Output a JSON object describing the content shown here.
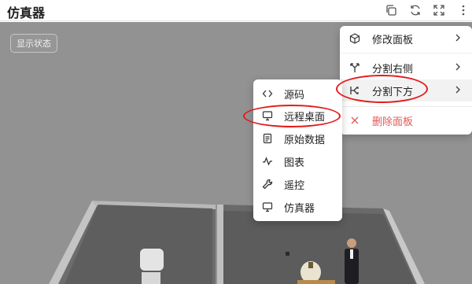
{
  "header": {
    "title": "仿真器",
    "icons": [
      "copy-icon",
      "refresh-icon",
      "expand-icon",
      "more-vertical-icon"
    ]
  },
  "scene": {
    "status_button": "显示状态"
  },
  "panel_menu": {
    "items": [
      {
        "label": "修改面板",
        "icon": "cube-icon",
        "has_submenu": true
      },
      {
        "label": "分割右侧",
        "icon": "split-right-icon",
        "has_submenu": true
      },
      {
        "label": "分割下方",
        "icon": "split-down-icon",
        "has_submenu": true
      },
      {
        "label": "删除面板",
        "icon": "close-icon",
        "has_submenu": false,
        "color": "#e35a55"
      }
    ]
  },
  "submenu": {
    "items": [
      {
        "label": "源码",
        "icon": "code-icon"
      },
      {
        "label": "远程桌面",
        "icon": "monitor-icon"
      },
      {
        "label": "原始数据",
        "icon": "document-icon"
      },
      {
        "label": "图表",
        "icon": "chart-line-icon"
      },
      {
        "label": "遥控",
        "icon": "wrench-icon"
      },
      {
        "label": "仿真器",
        "icon": "monitor-icon"
      }
    ]
  },
  "annotations": {
    "color": "#e21b1b",
    "highlighted": [
      "分割下方",
      "远程桌面"
    ]
  }
}
